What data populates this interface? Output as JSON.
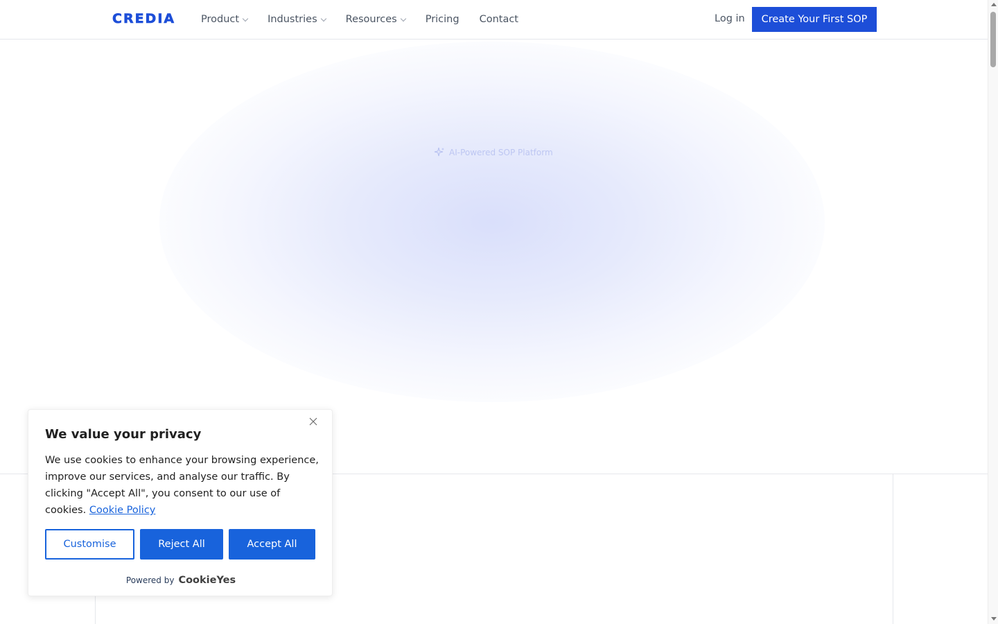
{
  "header": {
    "logo": "CREDIA",
    "nav": [
      {
        "label": "Product",
        "has_dropdown": true
      },
      {
        "label": "Industries",
        "has_dropdown": true
      },
      {
        "label": "Resources",
        "has_dropdown": true
      },
      {
        "label": "Pricing",
        "has_dropdown": false
      },
      {
        "label": "Contact",
        "has_dropdown": false
      }
    ],
    "login_label": "Log in",
    "cta_label": "Create Your First SOP"
  },
  "hero": {
    "badge_text": "AI-Powered SOP Platform",
    "badge_icon": "sparkle-icon"
  },
  "cookie_banner": {
    "title": "We value your privacy",
    "body": "We use cookies to enhance your browsing experience, improve our services, and analyse our traffic. By clicking \"Accept All\", you consent to our use of cookies.",
    "policy_link": "Cookie Policy",
    "customise_label": "Customise",
    "reject_label": "Reject All",
    "accept_label": "Accept All",
    "powered_by": "Powered by",
    "powered_brand": "CookieYes",
    "close_icon": "close-icon"
  },
  "colors": {
    "brand": "#1d4ed8",
    "cookie_accent": "#1863dc",
    "nav_text": "#4b5563",
    "border": "#e5e7eb"
  }
}
